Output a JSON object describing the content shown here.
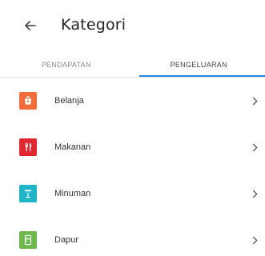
{
  "header": {
    "title": "Kategori",
    "back_icon": "arrow-left-icon"
  },
  "tabs": [
    {
      "label": "PENDAPATAN",
      "active": false
    },
    {
      "label": "PENGELUARAN",
      "active": true
    }
  ],
  "colors": {
    "accent": "#1e88e5",
    "belanja": "#f26b3a",
    "makanan": "#e0262e",
    "minuman": "#1fb4c8",
    "dapur": "#6cb84a"
  },
  "categories": [
    {
      "label": "Belanja",
      "icon": "shopping-bag-icon"
    },
    {
      "label": "Makanan",
      "icon": "fork-knife-icon"
    },
    {
      "label": "Minuman",
      "icon": "cocktail-glass-icon"
    },
    {
      "label": "Dapur",
      "icon": "refrigerator-icon"
    }
  ]
}
